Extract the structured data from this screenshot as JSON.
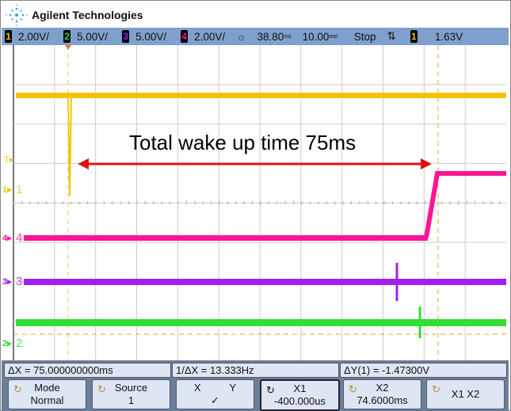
{
  "brand": "Agilent Technologies",
  "status": {
    "channels": [
      {
        "num": "1",
        "scale": "2.00V/",
        "color": "#f5c400"
      },
      {
        "num": "2",
        "scale": "5.00V/",
        "color": "#33dd33"
      },
      {
        "num": "3",
        "scale": "5.00V/",
        "color": "#a020f0"
      },
      {
        "num": "4",
        "scale": "2.00V/",
        "color": "#ff1493"
      }
    ],
    "delay": "38.80",
    "delay_unit": "ms",
    "timebase": "10.00",
    "timebase_unit": "ms/",
    "run_state": "Stop",
    "trigger_slope": "⇅",
    "trigger_source": "1",
    "trigger_level": "1.63V"
  },
  "annotation": "Total wake up time 75ms",
  "channel_labels": [
    "1",
    "4",
    "3",
    "2"
  ],
  "trigger_marker": "T",
  "measurements": {
    "delta_x": "ΔX = 75.000000000ms",
    "inv_delta_x": "1/ΔX = 13.333Hz",
    "delta_y": "ΔY(1) = -1.47300V"
  },
  "softkeys": [
    {
      "top": "Mode",
      "bottom": "Normal"
    },
    {
      "top": "Source",
      "bottom": "1"
    },
    {
      "top": "X          Y",
      "bottom": "✓"
    },
    {
      "top": "X1",
      "bottom": "-400.000us"
    },
    {
      "top": "X2",
      "bottom": "74.6000ms"
    },
    {
      "top": "X1 X2",
      "bottom": ""
    }
  ],
  "colors": {
    "ch1": "#f5c400",
    "ch2": "#33dd33",
    "ch3": "#a020f0",
    "ch4": "#ff1493",
    "cursor": "#f0a030",
    "arrow": "#dd1111",
    "status_bar": "#7fa0cc"
  }
}
